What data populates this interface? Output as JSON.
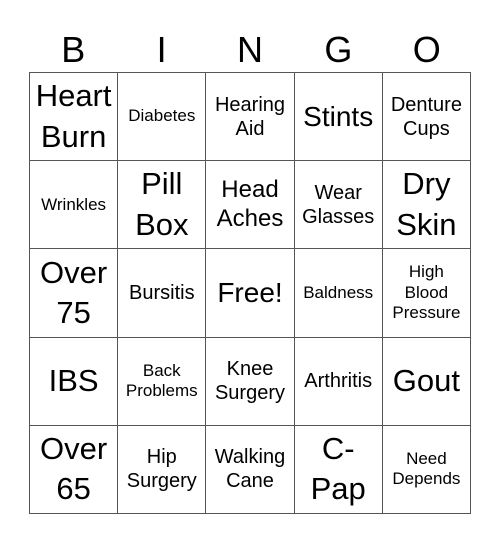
{
  "header": {
    "letters": [
      "B",
      "I",
      "N",
      "G",
      "O"
    ]
  },
  "card": {
    "rows": [
      [
        "Heart\nBurn",
        "Diabetes",
        "Hearing\nAid",
        "Stints",
        "Denture\nCups"
      ],
      [
        "Wrinkles",
        "Pill\nBox",
        "Head\nAches",
        "Wear\nGlasses",
        "Dry\nSkin"
      ],
      [
        "Over\n75",
        "Bursitis",
        "Free!",
        "Baldness",
        "High\nBlood\nPressure"
      ],
      [
        "IBS",
        "Back\nProblems",
        "Knee\nSurgery",
        "Arthritis",
        "Gout"
      ],
      [
        "Over\n65",
        "Hip\nSurgery",
        "Walking\nCane",
        "C-\nPap",
        "Need\nDepends"
      ]
    ],
    "free_space": "Free!"
  }
}
